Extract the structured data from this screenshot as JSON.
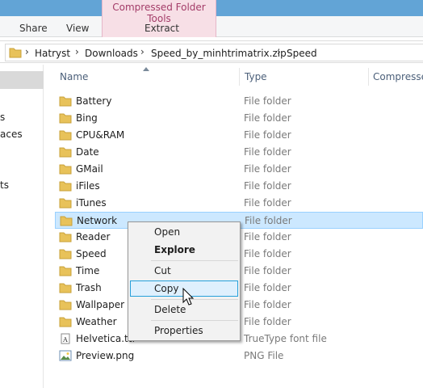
{
  "ribbon": {
    "context_title": "Compressed Folder Tools",
    "tabs": {
      "share": "Share",
      "view": "View",
      "extract": "Extract"
    }
  },
  "address": {
    "crumbs": [
      "Hatryst",
      "Downloads",
      "Speed_by_minhtrimatrix.zip",
      "Speed"
    ]
  },
  "nav_fragments": [
    "s",
    "aces",
    "ts"
  ],
  "columns": {
    "name": "Name",
    "type": "Type",
    "compressed": "Compressed"
  },
  "files": [
    {
      "name": "Battery",
      "type": "File folder",
      "icon": "folder-icon"
    },
    {
      "name": "Bing",
      "type": "File folder",
      "icon": "folder-icon"
    },
    {
      "name": "CPU&RAM",
      "type": "File folder",
      "icon": "folder-icon"
    },
    {
      "name": "Date",
      "type": "File folder",
      "icon": "folder-icon"
    },
    {
      "name": "GMail",
      "type": "File folder",
      "icon": "folder-icon"
    },
    {
      "name": "iFiles",
      "type": "File folder",
      "icon": "folder-icon"
    },
    {
      "name": "iTunes",
      "type": "File folder",
      "icon": "folder-icon"
    },
    {
      "name": "Network",
      "type": "File folder",
      "icon": "folder-icon",
      "selected": true
    },
    {
      "name": "Reader",
      "type": "File folder",
      "icon": "folder-icon"
    },
    {
      "name": "Speed",
      "type": "File folder",
      "icon": "folder-icon"
    },
    {
      "name": "Time",
      "type": "File folder",
      "icon": "folder-icon"
    },
    {
      "name": "Trash",
      "type": "File folder",
      "icon": "folder-icon"
    },
    {
      "name": "Wallpaper",
      "type": "File folder",
      "icon": "folder-icon"
    },
    {
      "name": "Weather",
      "type": "File folder",
      "icon": "folder-icon"
    },
    {
      "name": "Helvetica.ttf",
      "type": "TrueType font file",
      "icon": "font-file-icon"
    },
    {
      "name": "Preview.png",
      "type": "PNG File",
      "icon": "image-file-icon"
    }
  ],
  "context_menu": {
    "open": "Open",
    "explore": "Explore",
    "cut": "Cut",
    "copy": "Copy",
    "delete": "Delete",
    "properties": "Properties",
    "highlighted": "Copy"
  },
  "colors": {
    "selection": "#cce8ff",
    "context_tab": "#f7dfe6",
    "folder": "#e8c25a"
  }
}
